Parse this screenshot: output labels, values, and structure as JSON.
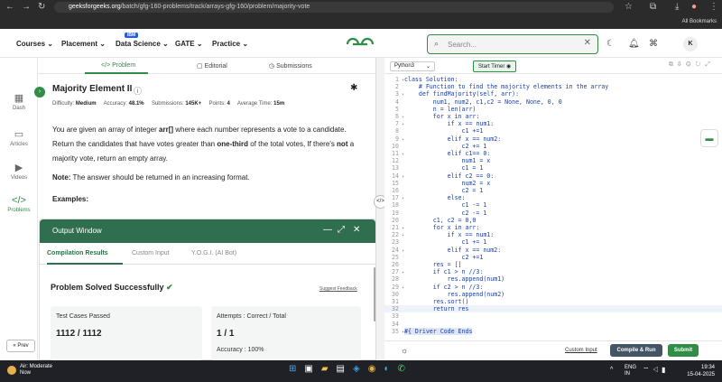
{
  "browser": {
    "url_host": "geeksforgeeks.org",
    "url_path": "/batch/gfg-160-problems/track/arrays-gfg-160/problem/majority-vote",
    "bookmarks": "All Bookmarks"
  },
  "topnav": {
    "menus": [
      "Courses",
      "Placement",
      "Data Science",
      "GATE",
      "Practice"
    ],
    "ibm_badge": "IBM",
    "logo": "GG",
    "search_placeholder": "Search...",
    "avatar": "K"
  },
  "sidebar": {
    "items": [
      "Dash",
      "Articles",
      "Videos",
      "Problems"
    ],
    "prev": "« Prev"
  },
  "tabs": [
    "Problem",
    "Editorial",
    "Submissions"
  ],
  "problem": {
    "title": "Majority Element II",
    "meta": {
      "difficulty_label": "Difficulty:",
      "difficulty": "Medium",
      "accuracy_label": "Accuracy:",
      "accuracy": "48.1%",
      "submissions_label": "Submissions:",
      "submissions": "145K+",
      "points_label": "Points:",
      "points": "4",
      "time_label": "Average Time:",
      "time": "15m"
    },
    "desc_1": "You are given an array of integer ",
    "desc_arr": "arr[]",
    "desc_2": " where each number represents a vote to a candidate. Return the candidates that have votes greater than ",
    "desc_third": "one-third",
    "desc_3": " of the total votes, If there's ",
    "desc_not": "not",
    "desc_4": " a majority vote, return an empty array.",
    "note_label": "Note:",
    "note": " The answer should be returned in an increasing format.",
    "examples": "Examples:"
  },
  "output": {
    "title": "Output Window",
    "tabs": [
      "Compilation Results",
      "Custom Input",
      "Y.O.G.I. (AI Bot)"
    ],
    "status": "Problem Solved Successfully",
    "suggest": "Suggest Feedback",
    "tests_label": "Test Cases Passed",
    "tests_value": "1112 / 1112",
    "attempts_label": "Attempts : Correct / Total",
    "attempts_value": "1 / 1",
    "accuracy_label": "Accuracy : ",
    "accuracy_value": "100%"
  },
  "editor": {
    "language": "Python3",
    "timer": "Start Timer",
    "custom_input": "Custom Input",
    "compile": "Compile & Run",
    "submit": "Submit",
    "lines": [
      {
        "n": "1",
        "fold": true,
        "text": "class Solution:"
      },
      {
        "n": "2",
        "fold": false,
        "text": "    # Function to find the majority elements in the array"
      },
      {
        "n": "3",
        "fold": true,
        "text": "    def findMajority(self, arr):"
      },
      {
        "n": "4",
        "fold": false,
        "text": "        num1, num2, c1,c2 = None, None, 0, 0"
      },
      {
        "n": "5",
        "fold": false,
        "text": "        n = len(arr)"
      },
      {
        "n": "6",
        "fold": true,
        "text": "        for x in arr:"
      },
      {
        "n": "7",
        "fold": true,
        "text": "            if x == num1:"
      },
      {
        "n": "8",
        "fold": false,
        "text": "                c1 +=1"
      },
      {
        "n": "9",
        "fold": true,
        "text": "            elif x == num2:"
      },
      {
        "n": "10",
        "fold": false,
        "text": "                c2 += 1"
      },
      {
        "n": "11",
        "fold": true,
        "text": "            elif c1== 0:"
      },
      {
        "n": "12",
        "fold": false,
        "text": "                num1 = x"
      },
      {
        "n": "13",
        "fold": false,
        "text": "                c1 = 1"
      },
      {
        "n": "14",
        "fold": true,
        "text": "            elif c2 == 0:"
      },
      {
        "n": "15",
        "fold": false,
        "text": "                num2 = x"
      },
      {
        "n": "16",
        "fold": false,
        "text": "                c2 = 1"
      },
      {
        "n": "17",
        "fold": true,
        "text": "            else:"
      },
      {
        "n": "18",
        "fold": false,
        "text": "                c1 -= 1"
      },
      {
        "n": "19",
        "fold": false,
        "text": "                c2 -= 1"
      },
      {
        "n": "20",
        "fold": false,
        "text": "        c1, c2 = 0,0"
      },
      {
        "n": "21",
        "fold": true,
        "text": "        for x in arr:"
      },
      {
        "n": "22",
        "fold": true,
        "text": "            if x == num1:"
      },
      {
        "n": "23",
        "fold": false,
        "text": "                c1 += 1"
      },
      {
        "n": "24",
        "fold": true,
        "text": "            elif x == num2:"
      },
      {
        "n": "25",
        "fold": false,
        "text": "                c2 +=1"
      },
      {
        "n": "26",
        "fold": false,
        "text": "        res = []"
      },
      {
        "n": "27",
        "fold": true,
        "text": "        if c1 > n //3:"
      },
      {
        "n": "28",
        "fold": false,
        "text": "            res.append(num1)"
      },
      {
        "n": "29",
        "fold": true,
        "text": "        if c2 > n //3:"
      },
      {
        "n": "30",
        "fold": false,
        "text": "            res.append(num2)"
      },
      {
        "n": "31",
        "fold": false,
        "text": "        res.sort()"
      },
      {
        "n": "32",
        "fold": false,
        "text": "        return res"
      },
      {
        "n": "33",
        "fold": false,
        "text": ""
      },
      {
        "n": "34",
        "fold": false,
        "text": ""
      },
      {
        "n": "35",
        "fold": true,
        "text": "#{ Driver Code Ends"
      }
    ]
  },
  "taskbar": {
    "weather_title": "Air: Moderate",
    "weather_sub": "Now",
    "lang_1": "ENG",
    "lang_2": "IN",
    "time": "19:34",
    "date": "15-04-2025"
  },
  "colors": {
    "brand": "#2f8d46",
    "output_header": "#2f6e4e"
  }
}
